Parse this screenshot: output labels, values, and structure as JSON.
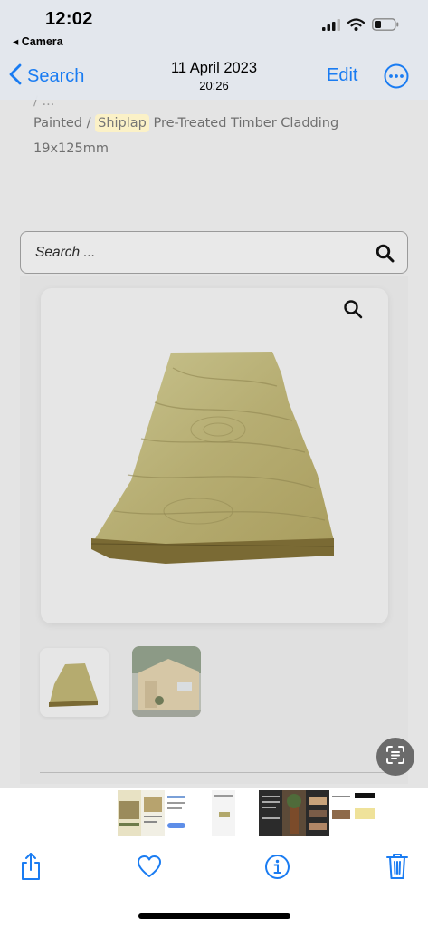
{
  "status_bar": {
    "time": "12:02",
    "back_app": "◂ Camera"
  },
  "nav": {
    "back_label": "Search",
    "date": "11 April 2023",
    "time": "20:26",
    "edit_label": "Edit"
  },
  "photo": {
    "product_title_partial": "/ ...",
    "product_title_pre": "Painted / ",
    "product_title_highlight": "Shiplap",
    "product_title_post": " Pre-Treated Timber Cladding",
    "product_size": "19x125mm",
    "search_placeholder": "Search ..."
  },
  "icons": {
    "back": "chevron-left-icon",
    "more": "ellipsis-circle-icon",
    "search": "magnifier-icon",
    "zoom": "magnifier-icon",
    "live_text": "live-text-icon",
    "share": "share-icon",
    "favorite": "heart-icon",
    "info": "info-icon",
    "delete": "trash-icon"
  },
  "colors": {
    "accent": "#1a7cf2",
    "highlight": "#fbf1c7"
  }
}
